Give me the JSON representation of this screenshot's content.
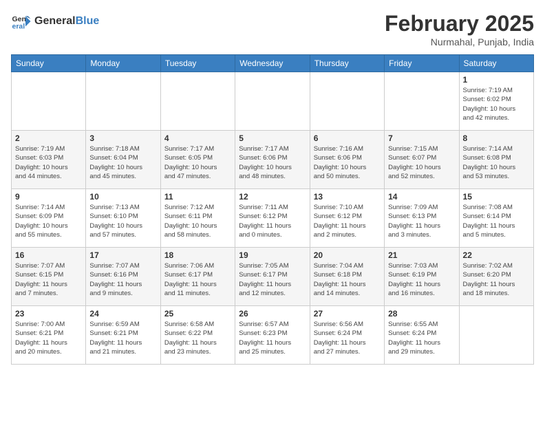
{
  "header": {
    "logo_general": "General",
    "logo_blue": "Blue",
    "month_title": "February 2025",
    "location": "Nurmahal, Punjab, India"
  },
  "weekdays": [
    "Sunday",
    "Monday",
    "Tuesday",
    "Wednesday",
    "Thursday",
    "Friday",
    "Saturday"
  ],
  "weeks": [
    [
      {
        "day": "",
        "info": ""
      },
      {
        "day": "",
        "info": ""
      },
      {
        "day": "",
        "info": ""
      },
      {
        "day": "",
        "info": ""
      },
      {
        "day": "",
        "info": ""
      },
      {
        "day": "",
        "info": ""
      },
      {
        "day": "1",
        "info": "Sunrise: 7:19 AM\nSunset: 6:02 PM\nDaylight: 10 hours\nand 42 minutes."
      }
    ],
    [
      {
        "day": "2",
        "info": "Sunrise: 7:19 AM\nSunset: 6:03 PM\nDaylight: 10 hours\nand 44 minutes."
      },
      {
        "day": "3",
        "info": "Sunrise: 7:18 AM\nSunset: 6:04 PM\nDaylight: 10 hours\nand 45 minutes."
      },
      {
        "day": "4",
        "info": "Sunrise: 7:17 AM\nSunset: 6:05 PM\nDaylight: 10 hours\nand 47 minutes."
      },
      {
        "day": "5",
        "info": "Sunrise: 7:17 AM\nSunset: 6:06 PM\nDaylight: 10 hours\nand 48 minutes."
      },
      {
        "day": "6",
        "info": "Sunrise: 7:16 AM\nSunset: 6:06 PM\nDaylight: 10 hours\nand 50 minutes."
      },
      {
        "day": "7",
        "info": "Sunrise: 7:15 AM\nSunset: 6:07 PM\nDaylight: 10 hours\nand 52 minutes."
      },
      {
        "day": "8",
        "info": "Sunrise: 7:14 AM\nSunset: 6:08 PM\nDaylight: 10 hours\nand 53 minutes."
      }
    ],
    [
      {
        "day": "9",
        "info": "Sunrise: 7:14 AM\nSunset: 6:09 PM\nDaylight: 10 hours\nand 55 minutes."
      },
      {
        "day": "10",
        "info": "Sunrise: 7:13 AM\nSunset: 6:10 PM\nDaylight: 10 hours\nand 57 minutes."
      },
      {
        "day": "11",
        "info": "Sunrise: 7:12 AM\nSunset: 6:11 PM\nDaylight: 10 hours\nand 58 minutes."
      },
      {
        "day": "12",
        "info": "Sunrise: 7:11 AM\nSunset: 6:12 PM\nDaylight: 11 hours\nand 0 minutes."
      },
      {
        "day": "13",
        "info": "Sunrise: 7:10 AM\nSunset: 6:12 PM\nDaylight: 11 hours\nand 2 minutes."
      },
      {
        "day": "14",
        "info": "Sunrise: 7:09 AM\nSunset: 6:13 PM\nDaylight: 11 hours\nand 3 minutes."
      },
      {
        "day": "15",
        "info": "Sunrise: 7:08 AM\nSunset: 6:14 PM\nDaylight: 11 hours\nand 5 minutes."
      }
    ],
    [
      {
        "day": "16",
        "info": "Sunrise: 7:07 AM\nSunset: 6:15 PM\nDaylight: 11 hours\nand 7 minutes."
      },
      {
        "day": "17",
        "info": "Sunrise: 7:07 AM\nSunset: 6:16 PM\nDaylight: 11 hours\nand 9 minutes."
      },
      {
        "day": "18",
        "info": "Sunrise: 7:06 AM\nSunset: 6:17 PM\nDaylight: 11 hours\nand 11 minutes."
      },
      {
        "day": "19",
        "info": "Sunrise: 7:05 AM\nSunset: 6:17 PM\nDaylight: 11 hours\nand 12 minutes."
      },
      {
        "day": "20",
        "info": "Sunrise: 7:04 AM\nSunset: 6:18 PM\nDaylight: 11 hours\nand 14 minutes."
      },
      {
        "day": "21",
        "info": "Sunrise: 7:03 AM\nSunset: 6:19 PM\nDaylight: 11 hours\nand 16 minutes."
      },
      {
        "day": "22",
        "info": "Sunrise: 7:02 AM\nSunset: 6:20 PM\nDaylight: 11 hours\nand 18 minutes."
      }
    ],
    [
      {
        "day": "23",
        "info": "Sunrise: 7:00 AM\nSunset: 6:21 PM\nDaylight: 11 hours\nand 20 minutes."
      },
      {
        "day": "24",
        "info": "Sunrise: 6:59 AM\nSunset: 6:21 PM\nDaylight: 11 hours\nand 21 minutes."
      },
      {
        "day": "25",
        "info": "Sunrise: 6:58 AM\nSunset: 6:22 PM\nDaylight: 11 hours\nand 23 minutes."
      },
      {
        "day": "26",
        "info": "Sunrise: 6:57 AM\nSunset: 6:23 PM\nDaylight: 11 hours\nand 25 minutes."
      },
      {
        "day": "27",
        "info": "Sunrise: 6:56 AM\nSunset: 6:24 PM\nDaylight: 11 hours\nand 27 minutes."
      },
      {
        "day": "28",
        "info": "Sunrise: 6:55 AM\nSunset: 6:24 PM\nDaylight: 11 hours\nand 29 minutes."
      },
      {
        "day": "",
        "info": ""
      }
    ]
  ]
}
